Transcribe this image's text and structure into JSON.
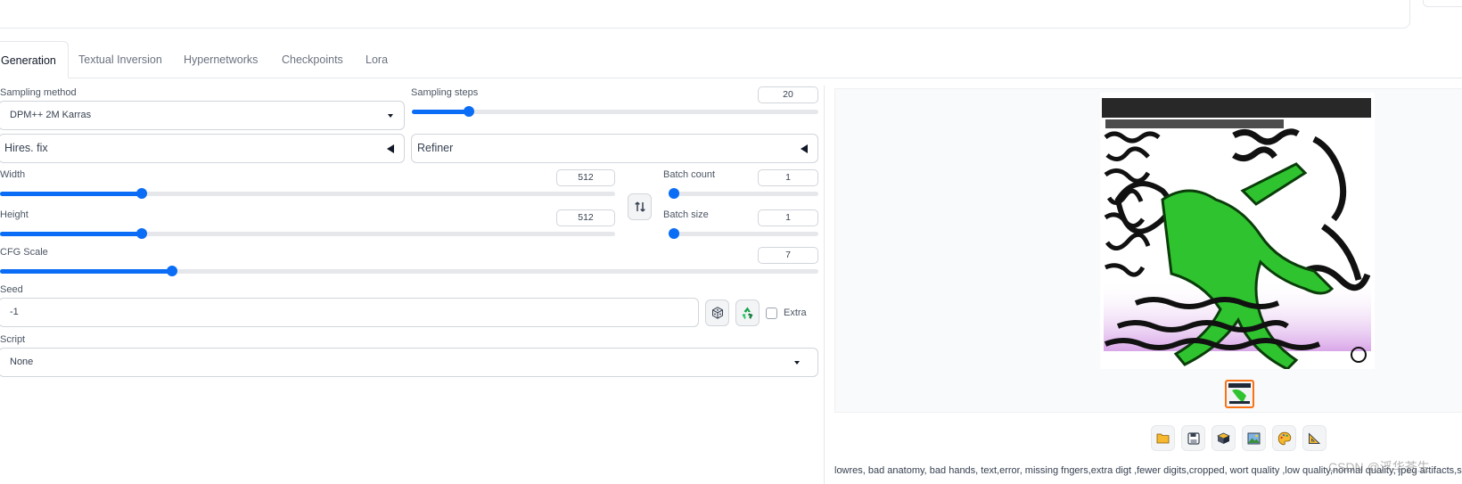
{
  "tabs": [
    "Generation",
    "Textual Inversion",
    "Hypernetworks",
    "Checkpoints",
    "Lora"
  ],
  "sampling_method": {
    "label": "Sampling method",
    "value": "DPM++ 2M Karras"
  },
  "sampling_steps": {
    "label": "Sampling steps",
    "value": "20",
    "fraction": 0.14
  },
  "hires_fix": {
    "label": "Hires. fix"
  },
  "refiner": {
    "label": "Refiner"
  },
  "width": {
    "label": "Width",
    "value": "512",
    "fraction": 0.23
  },
  "height": {
    "label": "Height",
    "value": "512",
    "fraction": 0.23
  },
  "batch_count": {
    "label": "Batch count",
    "value": "1",
    "fraction": 0.0
  },
  "batch_size": {
    "label": "Batch size",
    "value": "1",
    "fraction": 0.0
  },
  "cfg_scale": {
    "label": "CFG Scale",
    "value": "7",
    "fraction": 0.21
  },
  "seed": {
    "label": "Seed",
    "value": "-1",
    "extra_label": "Extra"
  },
  "script": {
    "label": "Script",
    "value": "None"
  },
  "result": {
    "caption": "lowres, bad anatomy, bad hands, text,error, missing fngers,extra digt ,fewer digits,cropped, wort quality ,low quality,normal quality, jpeg artifacts,signature",
    "toolbar_icons": [
      "folder-icon",
      "save-icon",
      "zip-icon",
      "image-icon",
      "palette-icon",
      "ruler-icon"
    ]
  },
  "watermark": "CSDN @浮华苍生",
  "colors": {
    "accent": "#0b6cf5",
    "thumbnail_border": "#f97316"
  }
}
